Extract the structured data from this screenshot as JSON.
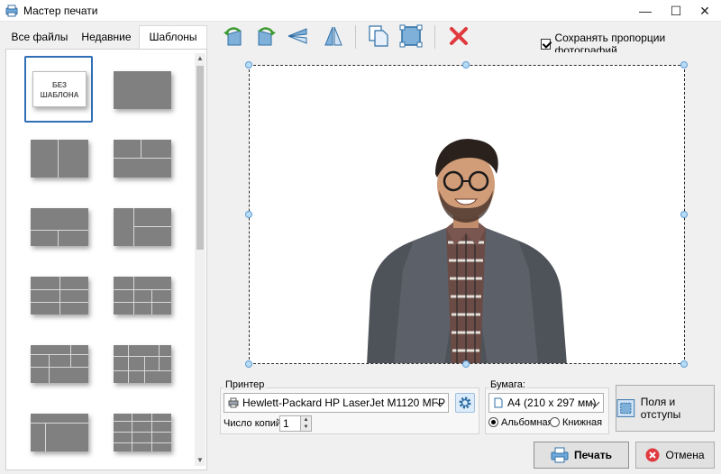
{
  "window": {
    "title": "Мастер печати",
    "minimize": "—",
    "maximize": "☐",
    "close": "✕"
  },
  "tabs": [
    {
      "label": "Все файлы"
    },
    {
      "label": "Недавние"
    },
    {
      "label": "Шаблоны",
      "active": true
    }
  ],
  "templates": {
    "none_label": "БЕЗ ШАБЛОНА",
    "selected_index": 0
  },
  "toolbar": {
    "icons": [
      "rotate-left-icon",
      "rotate-right-icon",
      "flip-horizontal-icon",
      "flip-vertical-icon",
      "copy-icon",
      "fit-frame-icon",
      "delete-icon"
    ],
    "keep_ratio_label": "Сохранять пропорции фотографий",
    "keep_ratio_checked": true
  },
  "printer": {
    "group_label": "Принтер",
    "name": "Hewlett-Packard HP LaserJet M1120 MFP",
    "copies_label": "Число копий:",
    "copies": "1"
  },
  "paper": {
    "group_label": "Бумага:",
    "size": "A4 (210 x 297 мм)",
    "landscape_label": "Альбомная",
    "portrait_label": "Книжная",
    "orientation": "landscape"
  },
  "buttons": {
    "fields": "Поля и отступы",
    "print": "Печать",
    "cancel": "Отмена"
  },
  "colors": {
    "accent": "#2f6fb5",
    "delete": "#e0393e"
  }
}
